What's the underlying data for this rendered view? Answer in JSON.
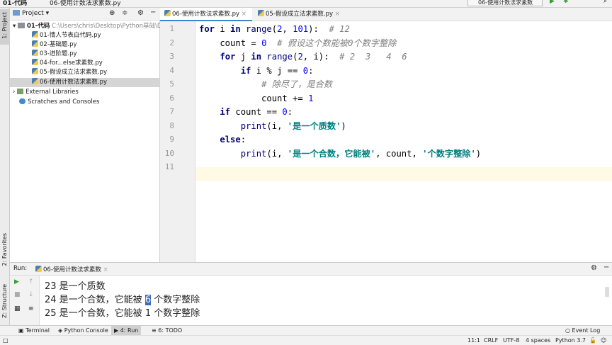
{
  "topbar": {
    "project_crumb": "01-代码",
    "file_crumb": "06-使用计数法求素数.py",
    "run_config": "06-使用计数法求素数"
  },
  "left_strip": {
    "project": "1: Project",
    "favorites": "2: Favorites",
    "structure": "Z: Structure"
  },
  "project_panel": {
    "title": "Project",
    "root": {
      "name": "01-代码",
      "path": "C:\\Users\\chris\\Desktop\\Python基础\\Da"
    },
    "files": [
      "01-情人节表白代码.py",
      "02-基础题.py",
      "03-进阶题.py",
      "04-for...else求素数.py",
      "05-假设成立法求素数.py",
      "06-使用计数法求素数.py"
    ],
    "selected_file": "06-使用计数法求素数.py",
    "external_libraries": "External Libraries",
    "scratches": "Scratches and Consoles"
  },
  "editor": {
    "tabs": [
      {
        "label": "06-使用计数法求素数.py",
        "active": true
      },
      {
        "label": "05-假设成立法求素数.py",
        "active": false
      }
    ],
    "current_line": 11,
    "lines": [
      [
        [
          "kw",
          "for"
        ],
        [
          "t",
          " i "
        ],
        [
          "kw",
          "in"
        ],
        [
          "bi",
          " range"
        ],
        [
          "t",
          "("
        ],
        [
          "num",
          "2"
        ],
        [
          "t",
          ", "
        ],
        [
          "num",
          "101"
        ],
        [
          "t",
          "):  "
        ],
        [
          "cm",
          "# 12"
        ]
      ],
      [
        [
          "t",
          "    count = "
        ],
        [
          "num",
          "0"
        ],
        [
          "t",
          "  "
        ],
        [
          "cm",
          "# 假设这个数能被0个数字整除"
        ]
      ],
      [
        [
          "t",
          "    "
        ],
        [
          "kw",
          "for"
        ],
        [
          "t",
          " j "
        ],
        [
          "kw",
          "in"
        ],
        [
          "bi",
          " range"
        ],
        [
          "t",
          "("
        ],
        [
          "num",
          "2"
        ],
        [
          "t",
          ", i):  "
        ],
        [
          "cm",
          "# 2  3   4  6"
        ]
      ],
      [
        [
          "t",
          "        "
        ],
        [
          "kw",
          "if"
        ],
        [
          "t",
          " i % j == "
        ],
        [
          "num",
          "0"
        ],
        [
          "t",
          ":"
        ]
      ],
      [
        [
          "t",
          "            "
        ],
        [
          "cm",
          "# 除尽了，是合数"
        ]
      ],
      [
        [
          "t",
          "            count += "
        ],
        [
          "num",
          "1"
        ]
      ],
      [
        [
          "t",
          "    "
        ],
        [
          "kw",
          "if"
        ],
        [
          "t",
          " count == "
        ],
        [
          "num",
          "0"
        ],
        [
          "t",
          ":"
        ]
      ],
      [
        [
          "t",
          "        "
        ],
        [
          "bi",
          "print"
        ],
        [
          "t",
          "(i, "
        ],
        [
          "str",
          "'是一个质数'"
        ],
        [
          "t",
          ")"
        ]
      ],
      [
        [
          "t",
          "    "
        ],
        [
          "kw",
          "else"
        ],
        [
          "t",
          ":"
        ]
      ],
      [
        [
          "t",
          "        "
        ],
        [
          "bi",
          "print"
        ],
        [
          "t",
          "(i, "
        ],
        [
          "str",
          "'是一个合数，它能被'"
        ],
        [
          "t",
          ", count, "
        ],
        [
          "str",
          "'个数字整除'"
        ],
        [
          "t",
          ")"
        ]
      ],
      []
    ]
  },
  "run_panel": {
    "label": "Run:",
    "tab": "06-使用计数法求素数",
    "output": [
      {
        "num": "23",
        "text": " 是一个质数"
      },
      {
        "num": "24",
        "pre": " 是一个合数，它能被 ",
        "count": "6",
        "post": " 个数字整除"
      },
      {
        "num": "25",
        "pre": " 是一个合数，它能被 ",
        "count": "1",
        "post": " 个数字整除"
      }
    ]
  },
  "tool_windows": {
    "terminal": "Terminal",
    "python_console": "Python Console",
    "run": "4: Run",
    "todo": "6: TODO",
    "event_log": "Event Log"
  },
  "status": {
    "position": "11:1",
    "line_sep": "CRLF",
    "encoding": "UTF-8",
    "indent": "4 spaces",
    "interpreter": "Python 3.7"
  }
}
